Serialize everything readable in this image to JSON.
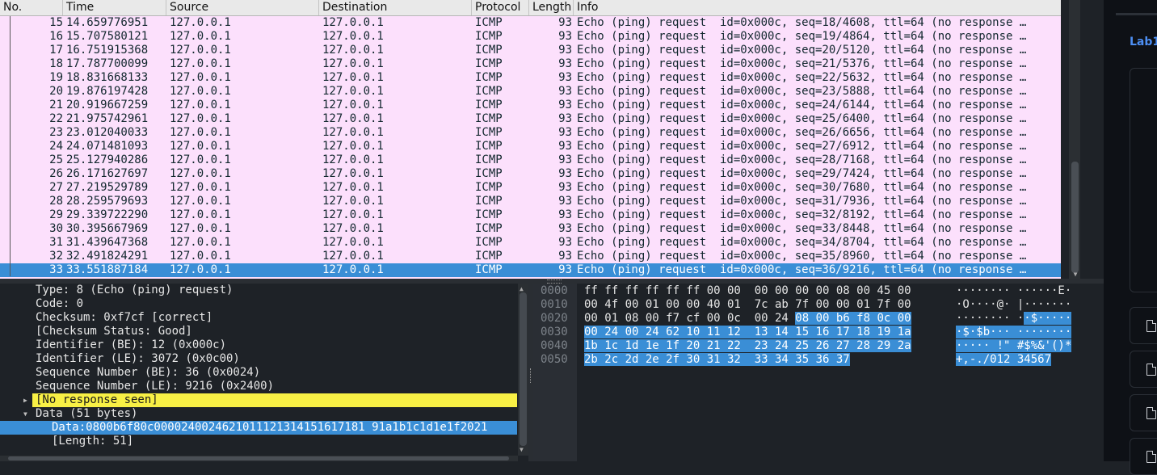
{
  "packet_list": {
    "columns": [
      "No.",
      "Time",
      "Source",
      "Destination",
      "Protocol",
      "Length",
      "Info"
    ],
    "rows": [
      {
        "no": "15",
        "time": "14.659776951",
        "src": "127.0.0.1",
        "dst": "127.0.0.1",
        "proto": "ICMP",
        "len": "93",
        "info": "Echo (ping) request  id=0x000c, seq=18/4608, ttl=64 (no response …"
      },
      {
        "no": "16",
        "time": "15.707580121",
        "src": "127.0.0.1",
        "dst": "127.0.0.1",
        "proto": "ICMP",
        "len": "93",
        "info": "Echo (ping) request  id=0x000c, seq=19/4864, ttl=64 (no response …"
      },
      {
        "no": "17",
        "time": "16.751915368",
        "src": "127.0.0.1",
        "dst": "127.0.0.1",
        "proto": "ICMP",
        "len": "93",
        "info": "Echo (ping) request  id=0x000c, seq=20/5120, ttl=64 (no response …"
      },
      {
        "no": "18",
        "time": "17.787700099",
        "src": "127.0.0.1",
        "dst": "127.0.0.1",
        "proto": "ICMP",
        "len": "93",
        "info": "Echo (ping) request  id=0x000c, seq=21/5376, ttl=64 (no response …"
      },
      {
        "no": "19",
        "time": "18.831668133",
        "src": "127.0.0.1",
        "dst": "127.0.0.1",
        "proto": "ICMP",
        "len": "93",
        "info": "Echo (ping) request  id=0x000c, seq=22/5632, ttl=64 (no response …"
      },
      {
        "no": "20",
        "time": "19.876197428",
        "src": "127.0.0.1",
        "dst": "127.0.0.1",
        "proto": "ICMP",
        "len": "93",
        "info": "Echo (ping) request  id=0x000c, seq=23/5888, ttl=64 (no response …"
      },
      {
        "no": "21",
        "time": "20.919667259",
        "src": "127.0.0.1",
        "dst": "127.0.0.1",
        "proto": "ICMP",
        "len": "93",
        "info": "Echo (ping) request  id=0x000c, seq=24/6144, ttl=64 (no response …"
      },
      {
        "no": "22",
        "time": "21.975742961",
        "src": "127.0.0.1",
        "dst": "127.0.0.1",
        "proto": "ICMP",
        "len": "93",
        "info": "Echo (ping) request  id=0x000c, seq=25/6400, ttl=64 (no response …"
      },
      {
        "no": "23",
        "time": "23.012040033",
        "src": "127.0.0.1",
        "dst": "127.0.0.1",
        "proto": "ICMP",
        "len": "93",
        "info": "Echo (ping) request  id=0x000c, seq=26/6656, ttl=64 (no response …"
      },
      {
        "no": "24",
        "time": "24.071481093",
        "src": "127.0.0.1",
        "dst": "127.0.0.1",
        "proto": "ICMP",
        "len": "93",
        "info": "Echo (ping) request  id=0x000c, seq=27/6912, ttl=64 (no response …"
      },
      {
        "no": "25",
        "time": "25.127940286",
        "src": "127.0.0.1",
        "dst": "127.0.0.1",
        "proto": "ICMP",
        "len": "93",
        "info": "Echo (ping) request  id=0x000c, seq=28/7168, ttl=64 (no response …"
      },
      {
        "no": "26",
        "time": "26.171627697",
        "src": "127.0.0.1",
        "dst": "127.0.0.1",
        "proto": "ICMP",
        "len": "93",
        "info": "Echo (ping) request  id=0x000c, seq=29/7424, ttl=64 (no response …"
      },
      {
        "no": "27",
        "time": "27.219529789",
        "src": "127.0.0.1",
        "dst": "127.0.0.1",
        "proto": "ICMP",
        "len": "93",
        "info": "Echo (ping) request  id=0x000c, seq=30/7680, ttl=64 (no response …"
      },
      {
        "no": "28",
        "time": "28.259579693",
        "src": "127.0.0.1",
        "dst": "127.0.0.1",
        "proto": "ICMP",
        "len": "93",
        "info": "Echo (ping) request  id=0x000c, seq=31/7936, ttl=64 (no response …"
      },
      {
        "no": "29",
        "time": "29.339722290",
        "src": "127.0.0.1",
        "dst": "127.0.0.1",
        "proto": "ICMP",
        "len": "93",
        "info": "Echo (ping) request  id=0x000c, seq=32/8192, ttl=64 (no response …"
      },
      {
        "no": "30",
        "time": "30.395667969",
        "src": "127.0.0.1",
        "dst": "127.0.0.1",
        "proto": "ICMP",
        "len": "93",
        "info": "Echo (ping) request  id=0x000c, seq=33/8448, ttl=64 (no response …"
      },
      {
        "no": "31",
        "time": "31.439647368",
        "src": "127.0.0.1",
        "dst": "127.0.0.1",
        "proto": "ICMP",
        "len": "93",
        "info": "Echo (ping) request  id=0x000c, seq=34/8704, ttl=64 (no response …"
      },
      {
        "no": "32",
        "time": "32.491824291",
        "src": "127.0.0.1",
        "dst": "127.0.0.1",
        "proto": "ICMP",
        "len": "93",
        "info": "Echo (ping) request  id=0x000c, seq=35/8960, ttl=64 (no response …"
      },
      {
        "no": "33",
        "time": "33.551887184",
        "src": "127.0.0.1",
        "dst": "127.0.0.1",
        "proto": "ICMP",
        "len": "93",
        "info": "Echo (ping) request  id=0x000c, seq=36/9216, ttl=64 (no response …"
      }
    ],
    "selected_no": "33"
  },
  "details": [
    {
      "text": "Type: 8 (Echo (ping) request)"
    },
    {
      "text": "Code: 0"
    },
    {
      "text": "Checksum: 0xf7cf [correct]"
    },
    {
      "text": "[Checksum Status: Good]"
    },
    {
      "text": "Identifier (BE): 12 (0x000c)"
    },
    {
      "text": "Identifier (LE): 3072 (0x0c00)"
    },
    {
      "text": "Sequence Number (BE): 36 (0x0024)"
    },
    {
      "text": "Sequence Number (LE): 9216 (0x2400)"
    },
    {
      "text": "[No response seen]"
    },
    {
      "text": "Data (51 bytes)"
    },
    {
      "text": "Data: 0800b6f80c0000240024621011121314151617181 91a1b1c1d1e1f2021"
    },
    {
      "text": "[Length: 51]"
    }
  ],
  "bytes": {
    "offsets": [
      "0000",
      "0010",
      "0020",
      "0030",
      "0040",
      "0050"
    ],
    "hex_plain": [
      "ff ff ff ff ff ff 00 00  00 00 00 00 08 00 45 00",
      "00 4f 00 01 00 00 40 01  7c ab 7f 00 00 01 7f 00",
      "00 01 08 00 f7 cf 00 0c  00 24 ",
      "",
      "",
      ""
    ],
    "hex_hl": [
      "",
      "",
      "08 00 b6 f8 0c 00",
      "00 24 00 24 62 10 11 12  13 14 15 16 17 18 19 1a",
      "1b 1c 1d 1e 1f 20 21 22  23 24 25 26 27 28 29 2a",
      "2b 2c 2d 2e 2f 30 31 32  33 34 35 36 37"
    ],
    "ascii_plain": [
      "········ ······E·",
      "·O····@· |·······",
      "········ ·",
      "",
      "",
      ""
    ],
    "ascii_hl": [
      "",
      "",
      "·$·····",
      "·$·$b··· ········",
      "····· !\" #$%&'()*",
      "+,-./012 34567"
    ]
  },
  "right_app": {
    "link": "Lab1"
  },
  "colors": {
    "list_bg": "#fce0fc",
    "selection": "#3a8ed6",
    "warning": "#f8f045",
    "accent": "#4d8ff3"
  }
}
